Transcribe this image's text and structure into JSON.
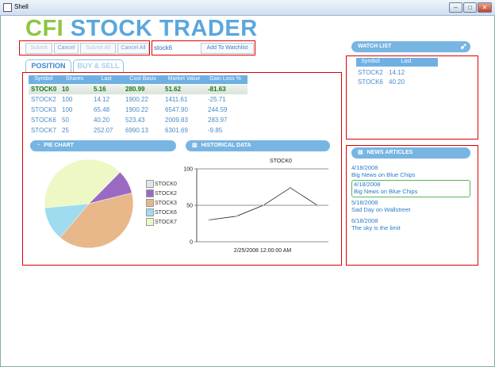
{
  "window": {
    "title": "Shell",
    "min_glyph": "–",
    "max_glyph": "□",
    "close_glyph": "✕"
  },
  "logo": {
    "part1": "CFI",
    "part2": "STOCK TRADER"
  },
  "toolbar": {
    "submit": "Submit",
    "cancel": "Cancel",
    "submit_all": "Submit All",
    "cancel_all": "Cancel All"
  },
  "watch_input": {
    "value": "stock6",
    "add_label": "Add To Watchlist"
  },
  "tabs": [
    {
      "label": "POSITION"
    },
    {
      "label": "BUY & SELL"
    }
  ],
  "positions": {
    "columns": [
      "Symbol",
      "Shares",
      "Last",
      "Cost Basis",
      "Market Value",
      "Gain Loss %"
    ],
    "rows": [
      [
        "STOCK0",
        "10",
        "5.16",
        "280.99",
        "51.62",
        "-81.63"
      ],
      [
        "STOCK2",
        "100",
        "14.12",
        "1900.22",
        "1411.61",
        "-25.71"
      ],
      [
        "STOCK3",
        "100",
        "65.48",
        "1900.22",
        "6547.90",
        "244.59"
      ],
      [
        "STOCK6",
        "50",
        "40.20",
        "523.43",
        "2009.83",
        "283.97"
      ],
      [
        "STOCK7",
        "25",
        "252.07",
        "6990.13",
        "6301.69",
        "-9.85"
      ]
    ]
  },
  "pie_panel": {
    "title": "PIE CHART",
    "legend": [
      {
        "name": "STOCK0",
        "color": "#dfe7e6"
      },
      {
        "name": "STOCK2",
        "color": "#9a6ac3"
      },
      {
        "name": "STOCK3",
        "color": "#e8b88a"
      },
      {
        "name": "STOCK6",
        "color": "#9fdcef"
      },
      {
        "name": "STOCK7",
        "color": "#eef8c4"
      }
    ]
  },
  "history_panel": {
    "title": "HISTORICAL DATA"
  },
  "watchlist": {
    "title": "WATCH LIST",
    "columns": [
      "Symbol",
      "Last"
    ],
    "rows": [
      [
        "STOCK2",
        "14.12"
      ],
      [
        "STOCK6",
        "40.20"
      ]
    ]
  },
  "news": {
    "title": "NEWS ARTICLES",
    "items": [
      {
        "date": "4/18/2008",
        "headline": "Big News on Blue Chips"
      },
      {
        "date": "4/18/2008",
        "headline": "Big News on Blue Chips"
      },
      {
        "date": "5/18/2008",
        "headline": "Sad Day on Wallstreet"
      },
      {
        "date": "6/18/2008",
        "headline": "The sky is the limit"
      }
    ]
  },
  "colors": {
    "accent": "#78b5e3",
    "logo_green": "#8cc63f",
    "logo_blue": "#5aa7dd",
    "highlight_box": "#e00000"
  },
  "chart_data": [
    {
      "type": "pie",
      "categories": [
        "STOCK0",
        "STOCK2",
        "STOCK3",
        "STOCK6",
        "STOCK7"
      ],
      "values": [
        51.62,
        1411.61,
        6547.9,
        2009.83,
        6301.69
      ],
      "legend": "right"
    },
    {
      "type": "line",
      "title": "STOCK0",
      "xlabel": "2/25/2008 12:00:00 AM",
      "ylim": [
        0,
        100
      ],
      "yticks": [
        0,
        50,
        100
      ],
      "series": [
        {
          "x": [
            1,
            2,
            3,
            4,
            5
          ],
          "values": [
            30,
            35,
            50,
            74,
            50
          ]
        }
      ]
    }
  ]
}
